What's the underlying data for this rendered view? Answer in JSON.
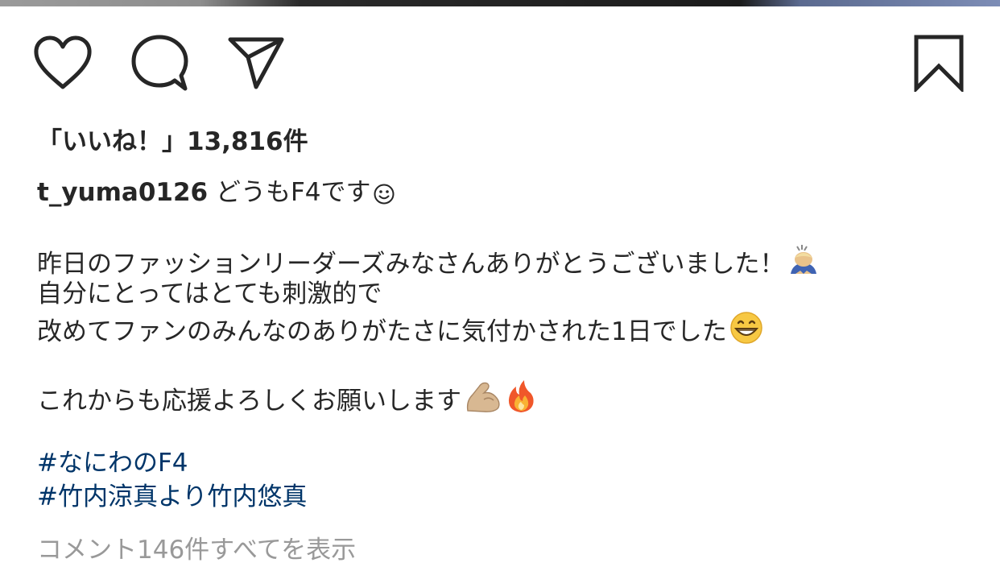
{
  "post": {
    "likes_text": "「いいね！」13,816件",
    "caption": {
      "username": "t_yuma0126",
      "first_line": "どうもF4です",
      "line2": "昨日のファッションリーダーズみなさんありがとうございました！",
      "line3": "自分にとってはとても刺激的で",
      "line4": "改めてファンのみんなのありがたさに気付かされた1日でした",
      "line6": "これからも応援よろしくお願いします",
      "hashtags": [
        "#なにわのF4",
        "#竹内涼真より竹内悠真"
      ]
    },
    "view_comments_text": "コメント146件すべてを表示"
  },
  "icons": {
    "like": "heart-icon",
    "comment": "speech-bubble-icon",
    "share": "paper-plane-icon",
    "save": "bookmark-icon",
    "emojis": [
      "smiling-face-icon",
      "bowing-person-icon",
      "grinning-face-icon",
      "flexed-biceps-icon",
      "fire-icon"
    ]
  },
  "colors": {
    "text": "#262626",
    "hashtag": "#003569",
    "muted": "#999999"
  }
}
